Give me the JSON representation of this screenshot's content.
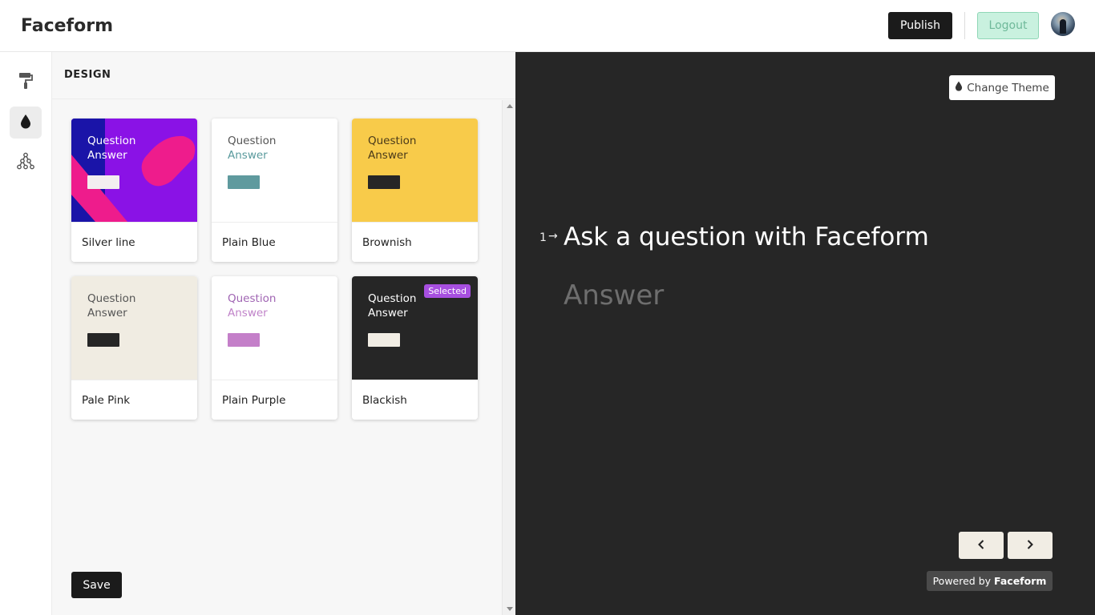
{
  "app": {
    "brand": "Faceform"
  },
  "header": {
    "publish_label": "Publish",
    "logout_label": "Logout"
  },
  "sidebar": {
    "icons": [
      "paint-roller-icon",
      "droplet-icon",
      "tree-structure-icon"
    ],
    "active_index": 1
  },
  "design_panel": {
    "title": "DESIGN",
    "themes": [
      {
        "name": "Silver line",
        "question": "Question",
        "answer": "Answer",
        "question_color": "#ffffff",
        "answer_color": "#ffffff",
        "swatch_color": "#f3eef0",
        "bg_color": "#7a16e8",
        "selected": false
      },
      {
        "name": "Plain Blue",
        "question": "Question",
        "answer": "Answer",
        "question_color": "#555555",
        "answer_color": "#5a9a9d",
        "swatch_color": "#5f9a9e",
        "bg_color": "#ffffff",
        "selected": false
      },
      {
        "name": "Brownish",
        "question": "Question",
        "answer": "Answer",
        "question_color": "#4a3a1a",
        "answer_color": "#4a3a1a",
        "swatch_color": "#262626",
        "bg_color": "#f8cb4a",
        "selected": false
      },
      {
        "name": "Pale Pink",
        "question": "Question",
        "answer": "Answer",
        "question_color": "#555555",
        "answer_color": "#555555",
        "swatch_color": "#262626",
        "bg_color": "#f0ece2",
        "selected": false
      },
      {
        "name": "Plain Purple",
        "question": "Question",
        "answer": "Answer",
        "question_color": "#a065b3",
        "answer_color": "#c083c9",
        "swatch_color": "#c47fc9",
        "bg_color": "#ffffff",
        "selected": false
      },
      {
        "name": "Blackish",
        "question": "Question",
        "answer": "Answer",
        "question_color": "#ffffff",
        "answer_color": "#ffffff",
        "swatch_color": "#f1ede4",
        "bg_color": "#262626",
        "selected": true,
        "badge": "Selected"
      }
    ],
    "save_label": "Save"
  },
  "preview": {
    "change_theme_label": "Change Theme",
    "question_number": "1",
    "question_text": "Ask a question with Faceform",
    "answer_placeholder": "Answer",
    "powered_prefix": "Powered by",
    "powered_brand": "Faceform"
  }
}
